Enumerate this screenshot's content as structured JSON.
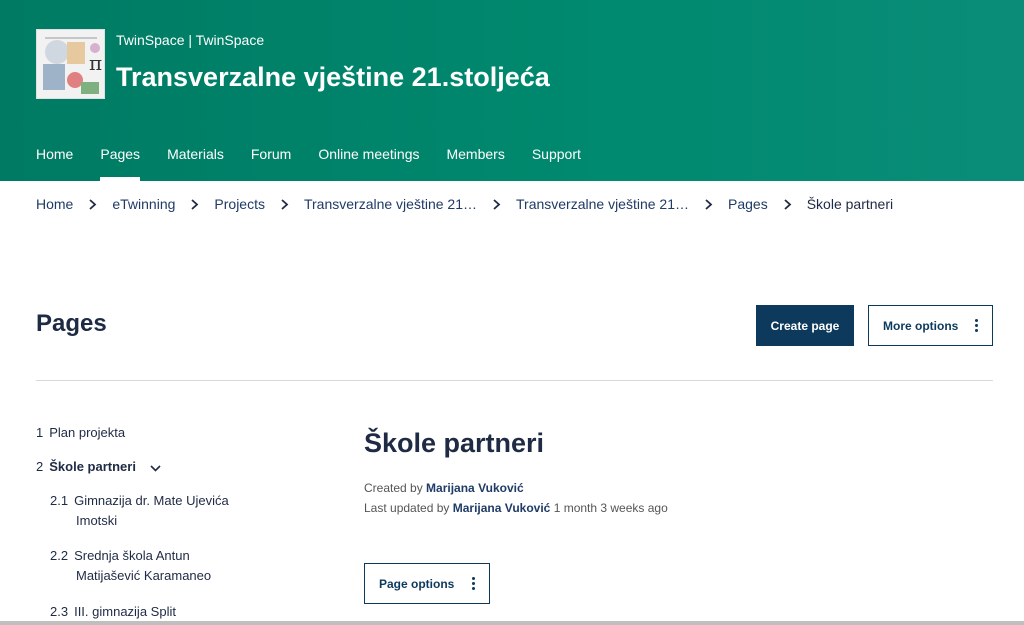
{
  "header": {
    "subtitle": "TwinSpace | TwinSpace",
    "title": "Transverzalne vještine 21.stoljeća",
    "nav": [
      {
        "label": "Home"
      },
      {
        "label": "Pages"
      },
      {
        "label": "Materials"
      },
      {
        "label": "Forum"
      },
      {
        "label": "Online meetings"
      },
      {
        "label": "Members"
      },
      {
        "label": "Support"
      }
    ],
    "active_nav": "Pages"
  },
  "breadcrumb": [
    {
      "label": "Home"
    },
    {
      "label": "eTwinning"
    },
    {
      "label": "Projects"
    },
    {
      "label": "Transverzalne vještine 21…"
    },
    {
      "label": "Transverzalne vještine 21…"
    },
    {
      "label": "Pages"
    },
    {
      "label": "Škole partneri"
    }
  ],
  "pages_header": {
    "title": "Pages",
    "create_label": "Create page",
    "more_label": "More options"
  },
  "tree": [
    {
      "num": "1",
      "label": "Plan projekta"
    },
    {
      "num": "2",
      "label": "Škole partneri"
    },
    {
      "num": "2.1",
      "label_line1": "Gimnazija dr. Mate Ujevića",
      "label_line2": "Imotski"
    },
    {
      "num": "2.2",
      "label_line1": "Srednja škola Antun",
      "label_line2": "Matijašević Karamaneo"
    },
    {
      "num": "2.3",
      "label": "III. gimnazija Split"
    }
  ],
  "content": {
    "title": "Škole partneri",
    "created_prefix": "Created by",
    "created_by": "Marijana Vuković",
    "updated_prefix": "Last updated by",
    "updated_by": "Marijana Vuković",
    "updated_when": "1 month 3 weeks ago",
    "page_options_label": "Page options"
  },
  "colors": {
    "header_bg": "#008a6f",
    "primary_button": "#0d3a5c",
    "link": "#1f3b66"
  }
}
